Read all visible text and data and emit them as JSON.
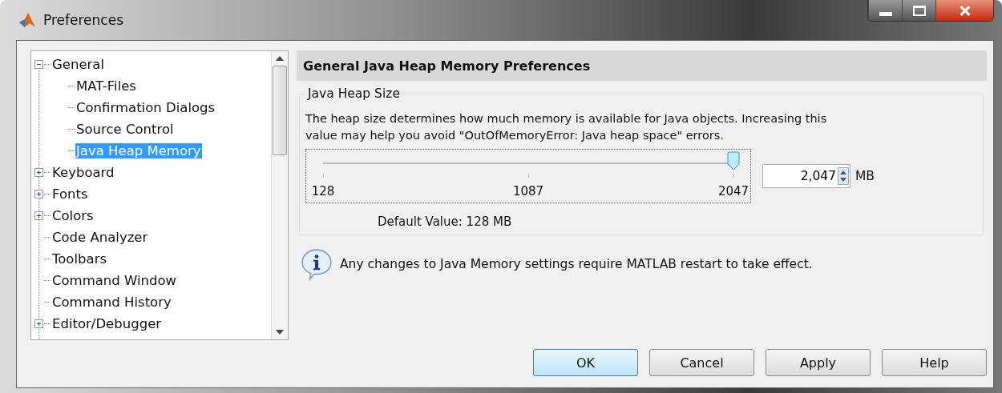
{
  "window": {
    "title": "Preferences"
  },
  "tree": [
    {
      "label": "General",
      "expanded": true,
      "selected": false,
      "children": [
        {
          "label": "MAT-Files",
          "selected": false
        },
        {
          "label": "Confirmation Dialogs",
          "selected": false
        },
        {
          "label": "Source Control",
          "selected": false
        },
        {
          "label": "Java Heap Memory",
          "selected": true
        }
      ]
    },
    {
      "label": "Keyboard",
      "expanded": false,
      "selected": false
    },
    {
      "label": "Fonts",
      "expanded": false,
      "selected": false
    },
    {
      "label": "Colors",
      "expanded": false,
      "selected": false
    },
    {
      "label": "Code Analyzer",
      "selected": false
    },
    {
      "label": "Toolbars",
      "selected": false
    },
    {
      "label": "Command Window",
      "selected": false
    },
    {
      "label": "Command History",
      "selected": false
    },
    {
      "label": "Editor/Debugger",
      "expanded": false,
      "selected": false
    }
  ],
  "panel": {
    "title": "General Java Heap Memory Preferences",
    "group": {
      "title": "Java Heap Size",
      "description": "The heap size determines how much memory is available for Java objects. Increasing this value may help you avoid \"OutOfMemoryError: Java heap space\" errors.",
      "slider": {
        "level": 1.0,
        "ticks": [
          "128",
          "1087",
          "2047"
        ]
      },
      "field": {
        "value": "2,047",
        "unit": "MB"
      },
      "default": "Default Value: 128 MB"
    },
    "note": "Any changes to Java Memory settings require MATLAB restart to take effect."
  },
  "buttons": [
    {
      "label": "OK",
      "default": true
    },
    {
      "label": "Cancel",
      "default": false
    },
    {
      "label": "Apply",
      "default": false
    },
    {
      "label": "Help",
      "default": false
    }
  ]
}
